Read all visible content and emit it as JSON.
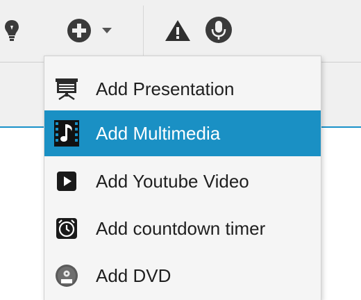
{
  "toolbar": {
    "items": [
      {
        "icon": "lightbulb-icon"
      },
      {
        "icon": "add-circle-icon"
      },
      {
        "icon": "dropdown-caret-icon"
      },
      {
        "icon": "warning-icon"
      },
      {
        "icon": "microphone-icon"
      }
    ]
  },
  "menu": {
    "items": [
      {
        "label": "Add Presentation",
        "icon": "presentation-icon",
        "selected": false
      },
      {
        "label": "Add Multimedia",
        "icon": "multimedia-film-icon",
        "selected": true
      },
      {
        "label": "Add Youtube Video",
        "icon": "youtube-play-icon",
        "selected": false
      },
      {
        "label": "Add countdown timer",
        "icon": "alarm-clock-icon",
        "selected": false
      },
      {
        "label": "Add DVD",
        "icon": "dvd-disc-icon",
        "selected": false
      }
    ]
  },
  "colors": {
    "selection": "#1a90c4",
    "accent_line": "#1991c9",
    "toolbar_bg": "#f0f0f0"
  }
}
